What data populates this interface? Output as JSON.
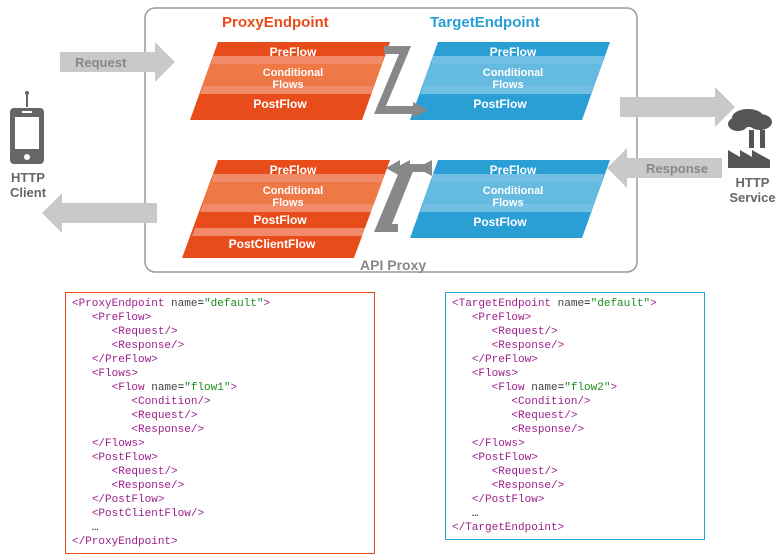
{
  "header": {
    "proxy_endpoint": "ProxyEndpoint",
    "target_endpoint": "TargetEndpoint"
  },
  "client": {
    "title": "HTTP",
    "sub": "Client"
  },
  "service": {
    "title": "HTTP",
    "sub": "Service"
  },
  "arrows": {
    "request": "Request",
    "response": "Response"
  },
  "container": {
    "label": "API Proxy"
  },
  "flows": {
    "preflow": "PreFlow",
    "conditional_l1": "Conditional",
    "conditional_l2": "Flows",
    "postflow": "PostFlow",
    "postclientflow": "PostClientFlow"
  },
  "code": {
    "proxy": {
      "open_tag": "ProxyEndpoint",
      "name_attr": "name",
      "name_val": "\"default\"",
      "preflow": "PreFlow",
      "request": "Request",
      "response": "Response",
      "flows": "Flows",
      "flow": "Flow",
      "flow_name_val": "\"flow1\"",
      "condition": "Condition",
      "postflow": "PostFlow",
      "postclientflow": "PostClientFlow",
      "ellipsis": "…"
    },
    "target": {
      "open_tag": "TargetEndpoint",
      "name_attr": "name",
      "name_val": "\"default\"",
      "preflow": "PreFlow",
      "request": "Request",
      "response": "Response",
      "flows": "Flows",
      "flow": "Flow",
      "flow_name_val": "\"flow2\"",
      "condition": "Condition",
      "postflow": "PostFlow",
      "ellipsis": "…"
    }
  }
}
